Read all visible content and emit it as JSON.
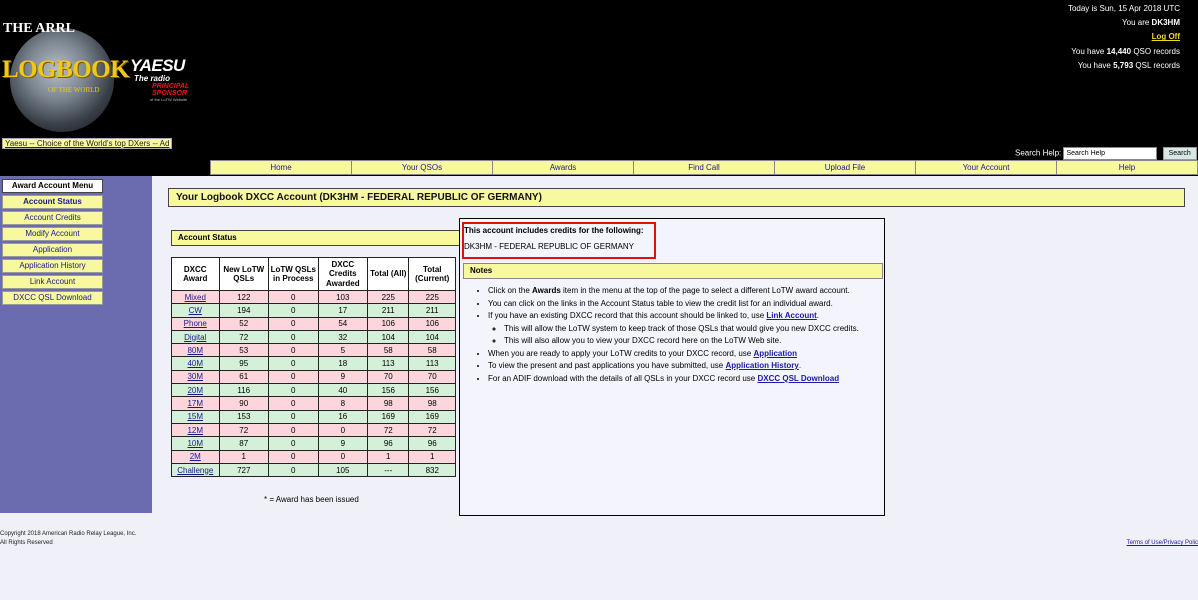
{
  "header": {
    "logo": {
      "top_text": "THE ARRL",
      "main_text": "LOGBOOK",
      "sub_text": "OF THE WORLD"
    },
    "sponsor": {
      "brand": "YAESU",
      "tagline": "The radio",
      "principal": "PRINCIPAL",
      "sponsor_word": "SPONSOR",
      "fine_print": "of the LoTW Website"
    },
    "ad_link": "Yaesu -- Choice of the World's top DXers -- Ad",
    "date_line": "Today is Sun, 15 Apr 2018 UTC",
    "you_are_prefix": "You are",
    "callsign": "DK3HM",
    "logoff": "Log Off",
    "qso_prefix": "You have",
    "qso_count": "14,440",
    "qso_suffix": "QSO records",
    "qsl_prefix": "You have",
    "qsl_count": "5,793",
    "qsl_suffix": "QSL records",
    "search_label": "Search Help:",
    "search_value": "Search Help",
    "search_button": "Search"
  },
  "nav": {
    "items": [
      "Home",
      "Your QSOs",
      "Awards",
      "Find Call",
      "Upload File",
      "Your Account",
      "Help"
    ]
  },
  "sidebar": {
    "title": "Award Account Menu",
    "items": [
      "Account Status",
      "Account Credits",
      "Modify Account",
      "Application",
      "Application History",
      "Link Account",
      "DXCC QSL Download"
    ]
  },
  "page_title": "Your Logbook DXCC Account (DK3HM - FEDERAL REPUBLIC OF GERMANY)",
  "status": {
    "heading": "Account Status",
    "columns": [
      "DXCC Award",
      "New LoTW QSLs",
      "LoTW QSLs in Process",
      "DXCC Credits Awarded",
      "Total (All)",
      "Total (Current)"
    ],
    "rows": [
      {
        "award": "Mixed",
        "new": "122",
        "process": "0",
        "credits": "103",
        "all": "225",
        "current": "225",
        "tone": "pink"
      },
      {
        "award": "CW",
        "new": "194",
        "process": "0",
        "credits": "17",
        "all": "211",
        "current": "211",
        "tone": "green"
      },
      {
        "award": "Phone",
        "new": "52",
        "process": "0",
        "credits": "54",
        "all": "106",
        "current": "106",
        "tone": "pink"
      },
      {
        "award": "Digital",
        "new": "72",
        "process": "0",
        "credits": "32",
        "all": "104",
        "current": "104",
        "tone": "green"
      },
      {
        "award": "80M",
        "new": "53",
        "process": "0",
        "credits": "5",
        "all": "58",
        "current": "58",
        "tone": "pink"
      },
      {
        "award": "40M",
        "new": "95",
        "process": "0",
        "credits": "18",
        "all": "113",
        "current": "113",
        "tone": "green"
      },
      {
        "award": "30M",
        "new": "61",
        "process": "0",
        "credits": "9",
        "all": "70",
        "current": "70",
        "tone": "pink"
      },
      {
        "award": "20M",
        "new": "116",
        "process": "0",
        "credits": "40",
        "all": "156",
        "current": "156",
        "tone": "green"
      },
      {
        "award": "17M",
        "new": "90",
        "process": "0",
        "credits": "8",
        "all": "98",
        "current": "98",
        "tone": "pink"
      },
      {
        "award": "15M",
        "new": "153",
        "process": "0",
        "credits": "16",
        "all": "169",
        "current": "169",
        "tone": "green"
      },
      {
        "award": "12M",
        "new": "72",
        "process": "0",
        "credits": "0",
        "all": "72",
        "current": "72",
        "tone": "pink"
      },
      {
        "award": "10M",
        "new": "87",
        "process": "0",
        "credits": "9",
        "all": "96",
        "current": "96",
        "tone": "green"
      },
      {
        "award": "2M",
        "new": "1",
        "process": "0",
        "credits": "0",
        "all": "1",
        "current": "1",
        "tone": "pink"
      },
      {
        "award": "Challenge",
        "new": "727",
        "process": "0",
        "credits": "105",
        "all": "---",
        "current": "832",
        "tone": "green"
      }
    ],
    "footnote": "* = Award has been issued"
  },
  "credits": {
    "title": "This account includes credits for the following:",
    "value": "DK3HM - FEDERAL REPUBLIC OF GERMANY",
    "highlight_color": "#e01010"
  },
  "notes": {
    "heading": "Notes",
    "n1_pre": "Click on the ",
    "n1_bold": "Awards",
    "n1_post": " item in the menu at the top of the page to select a different LoTW award account.",
    "n2": "You can click on the links in the Account Status table to view the credit list for an individual award.",
    "n3_pre": "If you have an existing DXCC record that this account should be linked to, use ",
    "n3_link": "Link Account",
    "n3_post": ".",
    "n3_sub1": "This will allow the LoTW system to keep track of those QSLs that would give you new DXCC credits.",
    "n3_sub2": "This will also allow you to view your DXCC record here on the LoTW Web site.",
    "n4_pre": "When you are ready to apply your LoTW credits to your DXCC record, use ",
    "n4_link": "Application",
    "n5_pre": "To view the present and past applications you have submitted, use ",
    "n5_link": "Application History",
    "n5_post": ".",
    "n6_pre": "For an ADIF download with the details of all QSLs in your DXCC record use ",
    "n6_link": "DXCC QSL Download"
  },
  "footer": {
    "copyright": "Copyright 2018 American Radio Relay League, Inc.",
    "rights": "All Rights Reserved",
    "terms": "Terms of Use/Privacy Polic"
  },
  "colors": {
    "header_bg": "#000000",
    "menu_bg": "#6b6bb0",
    "yellow": "#f8f8a0",
    "pink_row": "#fcd6dc",
    "green_row": "#d4f0d8"
  }
}
